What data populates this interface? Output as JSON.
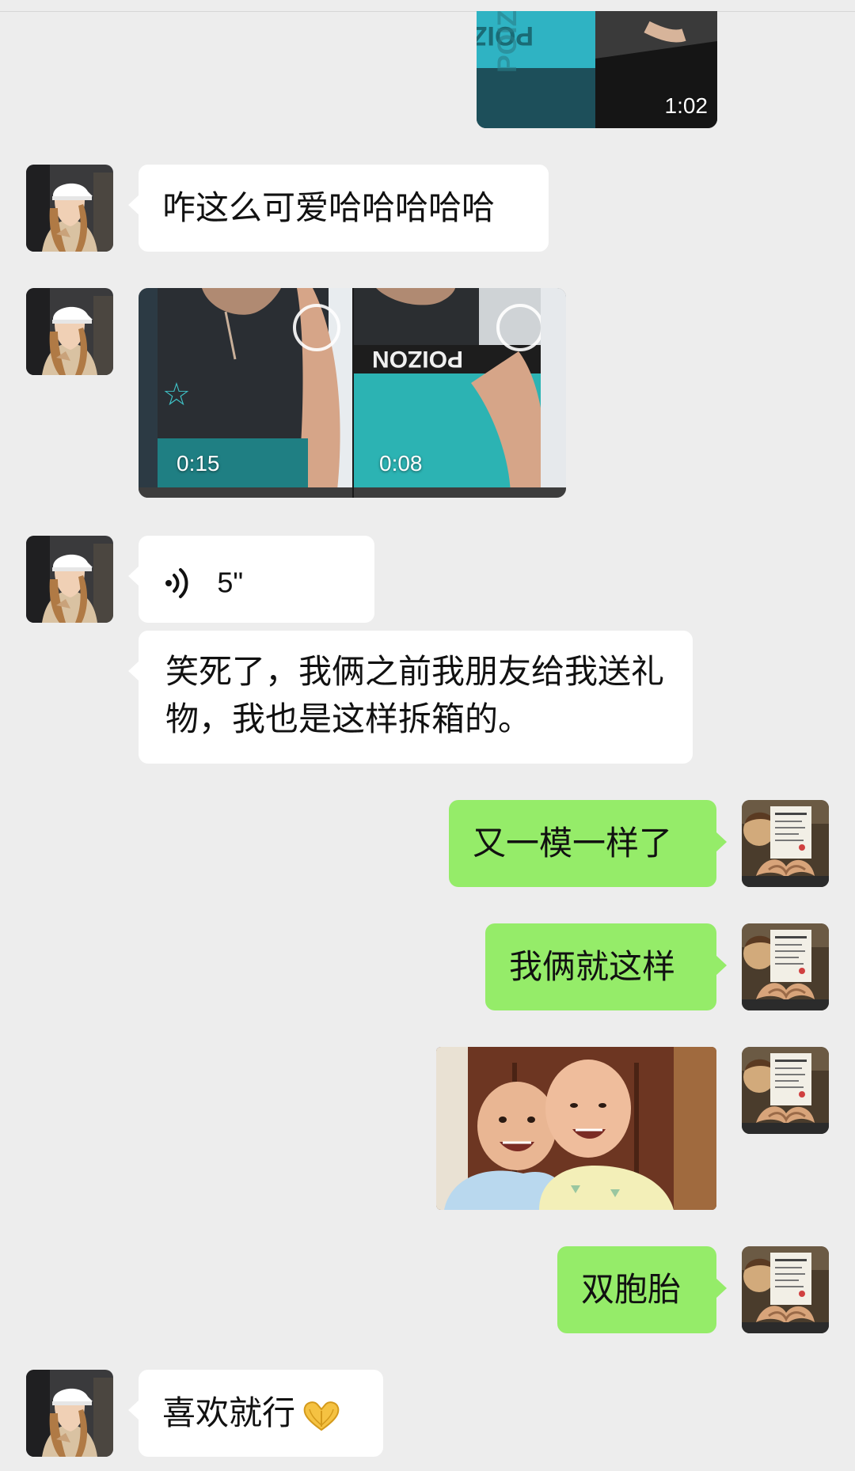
{
  "chat": {
    "messages": [
      {
        "type": "video",
        "side": "right",
        "duration": "1:02",
        "watermark": "POIZON"
      },
      {
        "type": "text",
        "side": "left",
        "text": "咋这么可爱哈哈哈哈哈"
      },
      {
        "type": "video-pair",
        "side": "left",
        "durations": [
          "0:15",
          "0:08"
        ],
        "watermark": "POIZON"
      },
      {
        "type": "voice",
        "side": "left",
        "duration": "5\""
      },
      {
        "type": "text",
        "side": "left",
        "text": "笑死了，我俩之前我朋友给我送礼物，我也是这样拆箱的。"
      },
      {
        "type": "text",
        "side": "right",
        "text": "又一模一样了"
      },
      {
        "type": "text",
        "side": "right",
        "text": "我俩就这样"
      },
      {
        "type": "image",
        "side": "right",
        "subject": "two smiling babies photo"
      },
      {
        "type": "text",
        "side": "right",
        "text": "双胞胎"
      },
      {
        "type": "text",
        "side": "left",
        "text": "喜欢就行",
        "emoji": "heart-hands-emoji"
      }
    ]
  },
  "icons": {
    "voice": "voice-wave-icon",
    "emoji": "heart-hands-emoji"
  },
  "colors": {
    "background": "#ededed",
    "incoming_bubble": "#ffffff",
    "outgoing_bubble": "#95ec69"
  }
}
